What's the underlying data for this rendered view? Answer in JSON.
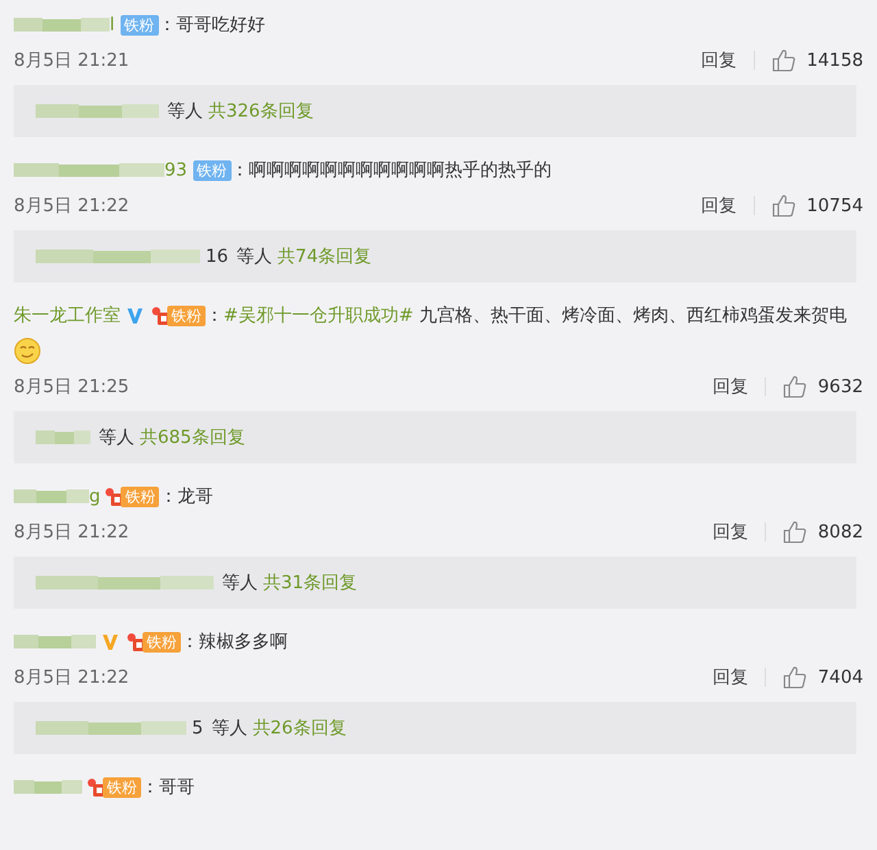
{
  "comments": [
    {
      "name_suffix": "l",
      "badge": {
        "label": "铁粉",
        "kind": "plain"
      },
      "content": [
        {
          "kind": "text",
          "text": "：哥哥吃好好"
        }
      ],
      "time": "8月5日 21:21",
      "reply_label": "回复",
      "likes": "14158",
      "replies": {
        "others": "等人",
        "count": "共326条回复"
      }
    },
    {
      "name_suffix": "93",
      "badge": {
        "label": "铁粉",
        "kind": "plain"
      },
      "content": [
        {
          "kind": "text",
          "text": "：啊啊啊啊啊啊啊啊啊啊啊热乎的热乎的"
        }
      ],
      "time": "8月5日 21:22",
      "reply_label": "回复",
      "likes": "10754",
      "replies": {
        "suffix": "16",
        "others": "等人",
        "count": "共74条回复"
      }
    },
    {
      "name": "朱一龙工作室",
      "verified": {
        "color": "#3ea4ee"
      },
      "badge": {
        "label": "铁粉",
        "kind": "crown"
      },
      "content": [
        {
          "kind": "text",
          "text": "："
        },
        {
          "kind": "hashtag",
          "text": "#吴邪十一仓升职成功#"
        },
        {
          "kind": "text",
          "text": " 九宫格、热干面、烤冷面、烤肉、西红柿鸡蛋发来贺电"
        }
      ],
      "emoji": true,
      "time": "8月5日 21:25",
      "reply_label": "回复",
      "likes": "9632",
      "replies": {
        "others": "等人",
        "count": "共685条回复"
      }
    },
    {
      "name_suffix": "g",
      "badge": {
        "label": "铁粉",
        "kind": "crown"
      },
      "content": [
        {
          "kind": "text",
          "text": "：龙哥"
        }
      ],
      "time": "8月5日 21:22",
      "reply_label": "回复",
      "likes": "8082",
      "replies": {
        "others": "等人",
        "count": "共31条回复"
      }
    },
    {
      "verified": {
        "color": "#f5a623"
      },
      "badge": {
        "label": "铁粉",
        "kind": "crown"
      },
      "content": [
        {
          "kind": "text",
          "text": "：辣椒多多啊"
        }
      ],
      "time": "8月5日 21:22",
      "reply_label": "回复",
      "likes": "7404",
      "replies": {
        "suffix": "5",
        "others": "等人",
        "count": "共26条回复"
      }
    },
    {
      "badge": {
        "label": "铁粉",
        "kind": "crown"
      },
      "content": [
        {
          "kind": "text",
          "text": "：哥哥"
        }
      ]
    }
  ]
}
